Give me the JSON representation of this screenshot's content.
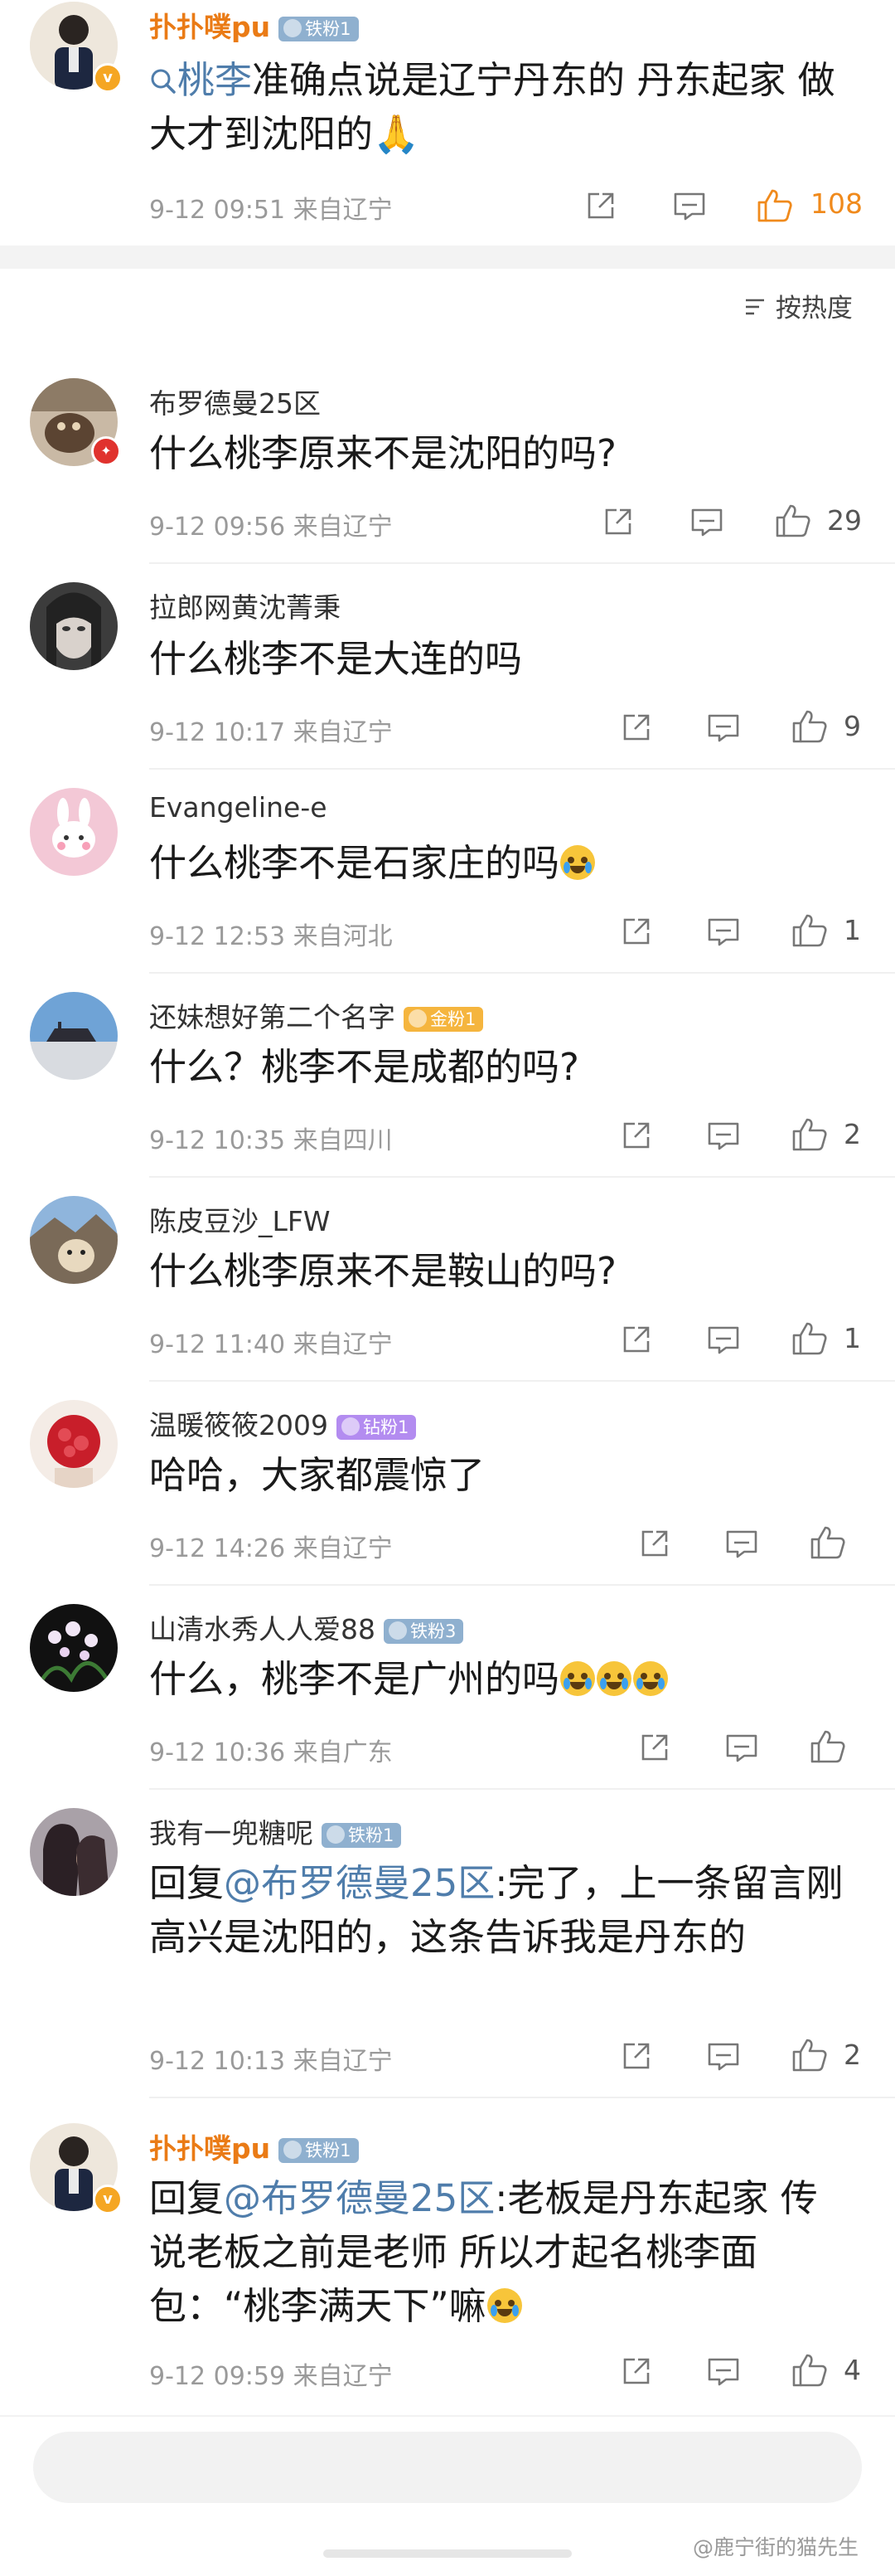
{
  "top": {
    "username": "扑扑噗pu",
    "fan_badge": "铁粉1",
    "topic": "桃李",
    "text": "准确点说是辽宁丹东的 丹东起家 做大才到沈阳的🙏",
    "time": "9-12 09:51",
    "location": "来自辽宁",
    "likes": "108"
  },
  "sort_label": "按热度",
  "comments": [
    {
      "username": "布罗德曼25区",
      "badge": "",
      "text": "什么桃李原来不是沈阳的吗?",
      "time": "9-12 09:56",
      "location": "来自辽宁",
      "likes": "29"
    },
    {
      "username": "拉郎网黄沈菁秉",
      "badge": "",
      "text": "什么桃李不是大连的吗",
      "time": "9-12 10:17",
      "location": "来自辽宁",
      "likes": "9"
    },
    {
      "username": "Evangeline-e",
      "badge": "",
      "text": "什么桃李不是石家庄的吗",
      "time": "9-12 12:53",
      "location": "来自河北",
      "likes": "1"
    },
    {
      "username": "还妹想好第二个名字",
      "badge": "金粉1",
      "text": "什么？桃李不是成都的吗?",
      "time": "9-12 10:35",
      "location": "来自四川",
      "likes": "2"
    },
    {
      "username": "陈皮豆沙_LFW",
      "badge": "",
      "text": "什么桃李原来不是鞍山的吗?",
      "time": "9-12 11:40",
      "location": "来自辽宁",
      "likes": "1"
    },
    {
      "username": "温暖筱筱2009",
      "badge": "钻粉1",
      "text": "哈哈，大家都震惊了",
      "time": "9-12 14:26",
      "location": "来自辽宁",
      "likes": ""
    },
    {
      "username": "山清水秀人人爱88",
      "badge": "铁粉3",
      "text": "什么，桃李不是广州的吗",
      "time": "9-12 10:36",
      "location": "来自广东",
      "likes": ""
    },
    {
      "username": "我有一兜糖呢",
      "badge": "铁粉1",
      "reply_prefix": "回复",
      "reply_to": "@布罗德曼25区",
      "text": ":完了，上一条留言刚高兴是沈阳的，这条告诉我是丹东的",
      "time": "9-12 10:13",
      "location": "来自辽宁",
      "likes": "2"
    },
    {
      "username": "扑扑噗pu",
      "badge": "铁粉1",
      "reply_prefix": "回复",
      "reply_to": "@布罗德曼25区",
      "text": ":老板是丹东起家 传说老板之前是老师 所以才起名桃李面包：“桃李满天下”嘛",
      "time": "9-12 09:59",
      "location": "来自辽宁",
      "likes": "4"
    }
  ],
  "watermark": "@鹿宁街的猫先生",
  "colors": {
    "accent_orange": "#ea7b16",
    "link_blue": "#4f7dab",
    "meta_gray": "#9a9a9a"
  },
  "icons": [
    "search-icon",
    "share-icon",
    "comment-icon",
    "like-icon",
    "sort-icon",
    "verified-icon",
    "emoji-cry-icon",
    "emoji-pray-icon"
  ]
}
